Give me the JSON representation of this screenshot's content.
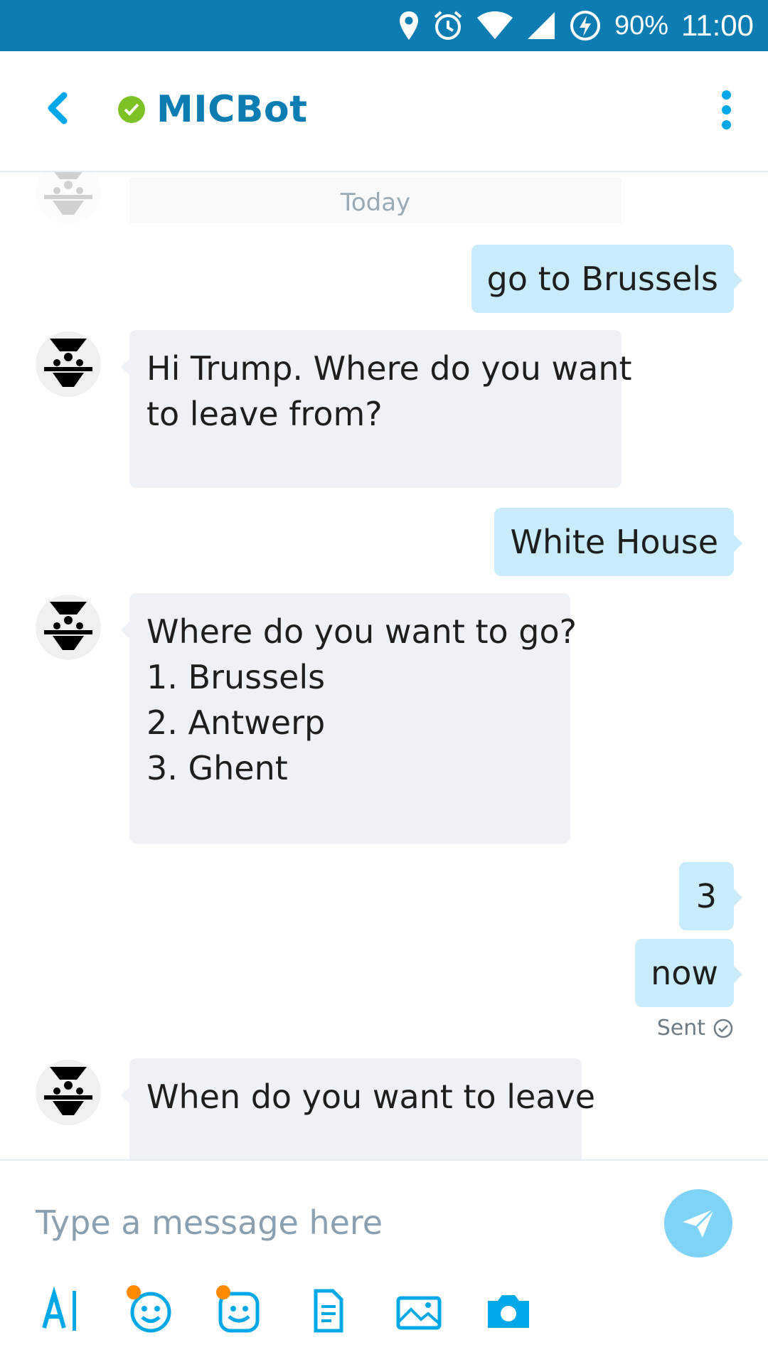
{
  "status_bar": {
    "battery": "90%",
    "time": "11:00",
    "icons": [
      "location-icon",
      "alarm-icon",
      "wifi-icon",
      "signal-icon",
      "battery-saver-icon"
    ]
  },
  "header": {
    "title": "MICBot",
    "presence": "online",
    "accent_color": "#0b7db3"
  },
  "chat": {
    "date_separator": "Today",
    "messages": [
      {
        "from": "user",
        "lines": [
          "go to Brussels"
        ]
      },
      {
        "from": "bot",
        "lines": [
          "Hi Trump. Where do you want",
          "to leave from?"
        ]
      },
      {
        "from": "user",
        "lines": [
          "White House"
        ]
      },
      {
        "from": "bot",
        "lines": [
          "Where do you want to go?",
          "1. Brussels",
          "2. Antwerp",
          "3. Ghent"
        ]
      },
      {
        "from": "user",
        "lines": [
          "3"
        ]
      },
      {
        "from": "user",
        "lines": [
          "now"
        ]
      },
      {
        "from": "bot",
        "lines": [
          "When do you want to leave"
        ]
      }
    ],
    "sent_status": "Sent"
  },
  "composer": {
    "placeholder": "Type a message here",
    "tools": [
      "text-format-icon",
      "emoji-icon",
      "sticker-icon",
      "file-icon",
      "gallery-icon",
      "camera-icon"
    ]
  }
}
